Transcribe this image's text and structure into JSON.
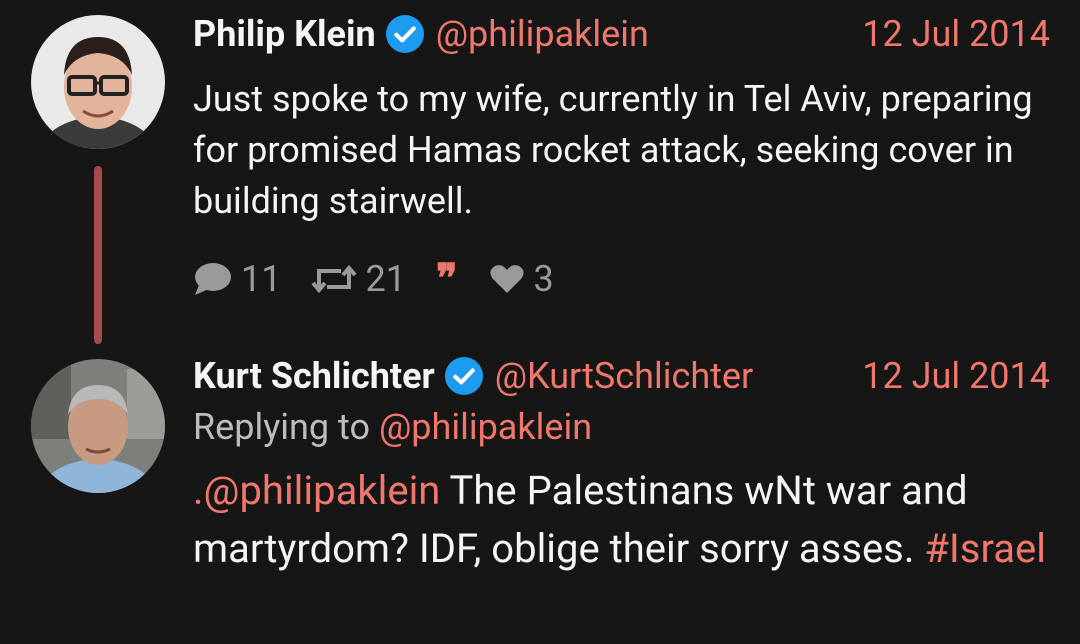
{
  "colors": {
    "background": "#161616",
    "accent": "#f0776d",
    "thread_line": "#a64b4b",
    "verified": "#1d9bf0",
    "muted": "#9a9a9a"
  },
  "tweets": [
    {
      "author": "Philip Klein",
      "handle": "@philipaklein",
      "date": "12 Jul 2014",
      "verified": true,
      "text": "Just spoke to my wife, currently in Tel Aviv, preparing for promised Hamas rocket attack, seeking cover in building stairwell.",
      "stats": {
        "replies": "11",
        "retweets": "21",
        "quote_icon": "❞",
        "likes": "3"
      }
    },
    {
      "author": "Kurt Schlichter",
      "handle": "@KurtSchlichter",
      "date": "12 Jul 2014",
      "verified": true,
      "replying_prefix": "Replying to",
      "replying_handle": "@philipaklein",
      "mention": ".@philipaklein",
      "text_main": " The Palestinans wNt war and martyrdom? IDF, oblige their sorry asses. ",
      "hashtag": "#Israel"
    }
  ]
}
